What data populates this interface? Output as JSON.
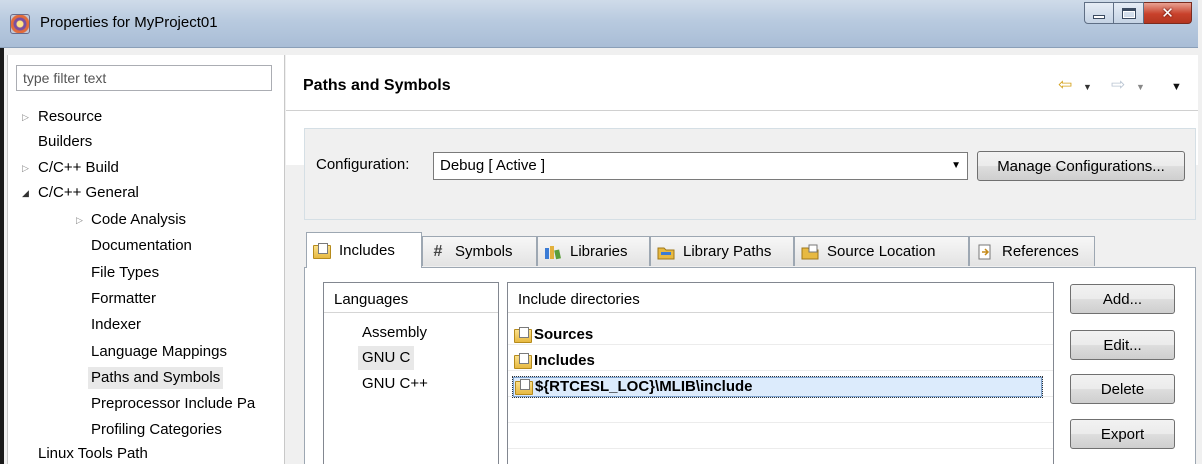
{
  "window": {
    "title": "Properties for MyProject01"
  },
  "nav": {
    "filter_placeholder": "type filter text",
    "items": [
      {
        "label": "Resource",
        "twisty": "▷"
      },
      {
        "label": "Builders",
        "twisty": ""
      },
      {
        "label": "C/C++ Build",
        "twisty": "▷"
      },
      {
        "label": "C/C++ General",
        "twisty": "◢"
      },
      {
        "label": "Code Analysis",
        "twisty": "▷"
      },
      {
        "label": "Documentation",
        "twisty": ""
      },
      {
        "label": "File Types",
        "twisty": ""
      },
      {
        "label": "Formatter",
        "twisty": ""
      },
      {
        "label": "Indexer",
        "twisty": ""
      },
      {
        "label": "Language Mappings",
        "twisty": ""
      },
      {
        "label": "Paths and Symbols",
        "twisty": "",
        "selected": true
      },
      {
        "label": "Preprocessor Include Pa",
        "twisty": ""
      },
      {
        "label": "Profiling Categories",
        "twisty": ""
      },
      {
        "label": "Linux Tools Path",
        "twisty": ""
      }
    ]
  },
  "page": {
    "title": "Paths and Symbols"
  },
  "config": {
    "label": "Configuration:",
    "value": "Debug  [ Active ]",
    "manage_label": "Manage Configurations..."
  },
  "tabs": [
    {
      "label": "Includes",
      "icon": "folder-include-icon",
      "active": true
    },
    {
      "label": "Symbols",
      "icon": "hash-icon"
    },
    {
      "label": "Libraries",
      "icon": "books-icon"
    },
    {
      "label": "Library Paths",
      "icon": "folder-path-icon"
    },
    {
      "label": "Source Location",
      "icon": "source-folder-icon"
    },
    {
      "label": "References",
      "icon": "references-icon"
    }
  ],
  "languages": {
    "header": "Languages",
    "items": [
      "Assembly",
      "GNU C",
      "GNU C++"
    ],
    "selected": "GNU C"
  },
  "includes": {
    "header": "Include directories",
    "items": [
      "Sources",
      "Includes",
      "${RTCESL_LOC}\\MLIB\\include"
    ],
    "selected": "${RTCESL_LOC}\\MLIB\\include"
  },
  "buttons": {
    "add": "Add...",
    "edit": "Edit...",
    "delete": "Delete",
    "export": "Export"
  }
}
